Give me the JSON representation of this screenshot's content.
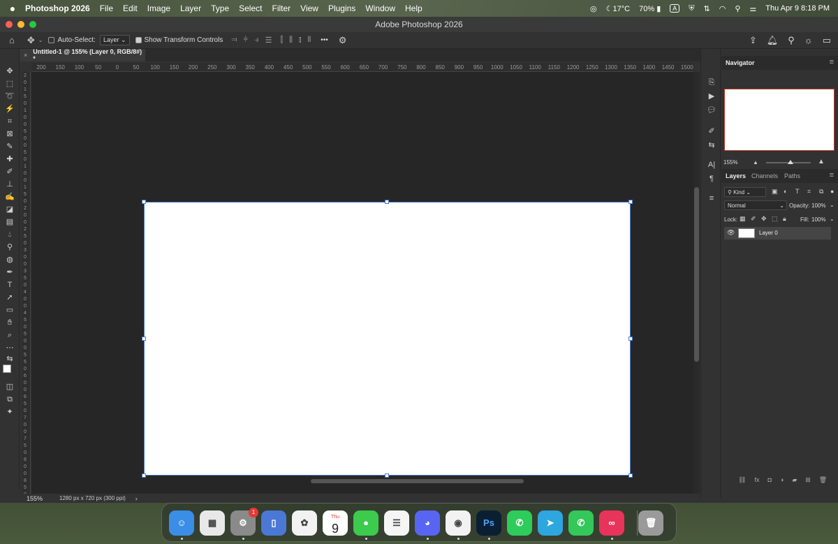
{
  "menubar": {
    "app_name": "Photoshop 2026",
    "items": [
      "File",
      "Edit",
      "Image",
      "Layer",
      "Type",
      "Select",
      "Filter",
      "View",
      "Plugins",
      "Window",
      "Help"
    ],
    "temperature": "17°C",
    "battery": "70%",
    "input_source": "A",
    "datetime": "Thu Apr 9  8:18 PM"
  },
  "window": {
    "title": "Adobe Photoshop 2026",
    "traffic_colors": [
      "#ff5f57",
      "#febc2e",
      "#28c840"
    ]
  },
  "options_bar": {
    "auto_select_label": "Auto-Select:",
    "auto_select_value": "Layer",
    "transform_controls_label": "Show Transform Controls",
    "more": "•••"
  },
  "document_tab": {
    "close": "×",
    "title": "Untitled-1 @ 155% (Layer 0, RGB/8#) *"
  },
  "ruler_top": [
    "200",
    "150",
    "100",
    "50",
    "0",
    "50",
    "100",
    "150",
    "200",
    "250",
    "300",
    "350",
    "400",
    "450",
    "500",
    "550",
    "600",
    "650",
    "700",
    "750",
    "800",
    "850",
    "900",
    "950",
    "1000",
    "1050",
    "1100",
    "1150",
    "1200",
    "1250",
    "1300",
    "1350",
    "1400",
    "1450",
    "1500"
  ],
  "ruler_left": [
    "2",
    "0",
    "1",
    "5",
    "0",
    "1",
    "0",
    "0",
    "5",
    "0",
    "0",
    "5",
    "0",
    "1",
    "0",
    "0",
    "1",
    "5",
    "0",
    "2",
    "0",
    "0",
    "2",
    "5",
    "0",
    "3",
    "0",
    "0",
    "3",
    "5",
    "0",
    "4",
    "0",
    "0",
    "4",
    "5",
    "0",
    "5",
    "0",
    "0",
    "5",
    "5",
    "0",
    "6",
    "0",
    "0",
    "6",
    "5",
    "0",
    "7",
    "0",
    "0",
    "7",
    "5",
    "0",
    "8",
    "0",
    "0",
    "8",
    "5",
    "0",
    "9"
  ],
  "status": {
    "zoom": "155%",
    "doc_info": "1280 px x 720 px (300 ppi)",
    "arrow": "›"
  },
  "navigator": {
    "title": "Navigator",
    "zoom": "155%"
  },
  "layers_panel": {
    "tabs": [
      "Layers",
      "Channels",
      "Paths"
    ],
    "filter_kind": "Kind",
    "blend_mode": "Normal",
    "opacity_label": "Opacity:",
    "opacity_value": "100%",
    "lock_label": "Lock:",
    "fill_label": "Fill:",
    "fill_value": "100%",
    "layers": [
      {
        "name": "Layer 0",
        "visible": true
      }
    ]
  },
  "dock": {
    "apps": [
      {
        "name": "Finder",
        "glyph": "☺",
        "color": "#3a8ee6",
        "running": true
      },
      {
        "name": "Launchpad",
        "glyph": "▦",
        "color": "#e8e8e8",
        "running": false
      },
      {
        "name": "System Settings",
        "glyph": "⚙",
        "color": "#8a8a8a",
        "running": true,
        "badge": "1"
      },
      {
        "name": "Simulator",
        "glyph": "▯",
        "color": "#4a78d4",
        "running": false
      },
      {
        "name": "Photos",
        "glyph": "✿",
        "color": "#f2f2f2",
        "running": false
      },
      {
        "name": "Calendar",
        "glyph": "9",
        "color": "#ffffff",
        "running": false,
        "label_top": "Thu"
      },
      {
        "name": "Messages",
        "glyph": "●",
        "color": "#3ccb4d",
        "running": true
      },
      {
        "name": "Reminders",
        "glyph": "☰",
        "color": "#f5f5f5",
        "running": false
      },
      {
        "name": "Discord",
        "glyph": "◕",
        "color": "#5865f2",
        "running": true
      },
      {
        "name": "Chrome",
        "glyph": "◉",
        "color": "#f2f2f2",
        "running": true
      },
      {
        "name": "Photoshop",
        "glyph": "Ps",
        "color": "#0b1f33",
        "running": true
      },
      {
        "name": "WhatsApp",
        "glyph": "✆",
        "color": "#2ecc5a",
        "running": false
      },
      {
        "name": "Telegram",
        "glyph": "➤",
        "color": "#2ea6e0",
        "running": false
      },
      {
        "name": "Phone",
        "glyph": "✆",
        "color": "#34c759",
        "running": false
      },
      {
        "name": "Creative Cloud",
        "glyph": "∞",
        "color": "#e8345a",
        "running": true
      },
      {
        "name": "Trash",
        "glyph": "🗑",
        "color": "#9a9a9a",
        "running": false
      }
    ]
  },
  "colors": {
    "selection": "#4a7bd0",
    "navigator_frame": "#c0392b",
    "canvas_bg": "#262626",
    "panel_bg": "#323232"
  }
}
